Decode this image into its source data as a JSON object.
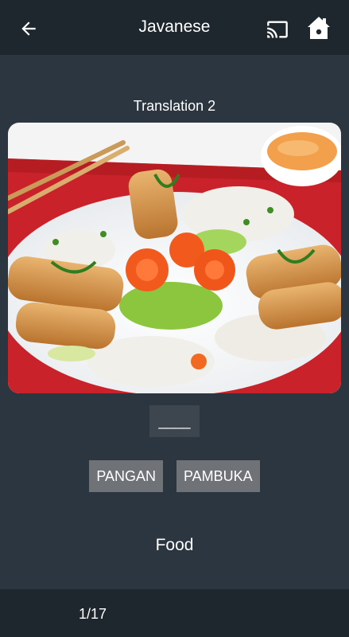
{
  "header": {
    "title": "Javanese",
    "back_icon": "arrow-left-icon",
    "cast_icon": "cast-icon",
    "home_icon": "home-icon"
  },
  "quiz": {
    "subtitle": "Translation 2",
    "image_description_icon": "food-photo",
    "blank": "____",
    "choices": [
      "PANGAN",
      "PAMBUKA"
    ],
    "meaning": "Food"
  },
  "footer": {
    "counter": "1/17"
  },
  "colors": {
    "background": "#2c3640",
    "bar": "#1f272e",
    "choice_button": "#6f7377",
    "blank_box": "#3d464f"
  }
}
